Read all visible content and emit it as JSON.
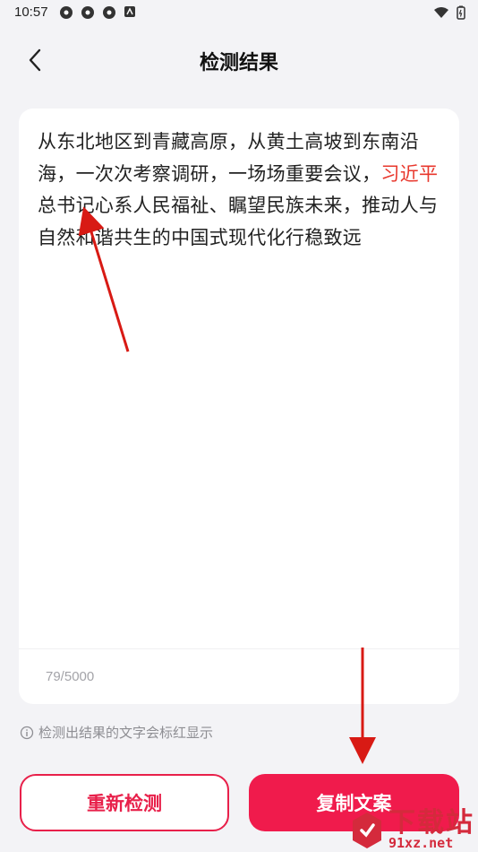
{
  "status_bar": {
    "time": "10:57"
  },
  "header": {
    "title": "检测结果"
  },
  "result": {
    "text_before": "从东北地区到青藏高原，从黄土高坡到东南沿海，一次次考察调研，一场场重要会议，",
    "highlighted": "习近平",
    "text_after": "总书记心系人民福祉、瞩望民族未来，推动人与自然和谐共生的中国式现代化行稳致远",
    "char_count": "79/5000"
  },
  "hint": {
    "text": "检测出结果的文字会标红显示"
  },
  "buttons": {
    "redetect": "重新检测",
    "copy": "复制文案"
  },
  "watermark": {
    "title": "下载站",
    "url": "91xz.net"
  },
  "colors": {
    "accent": "#f01b4c",
    "highlight": "#e8372c",
    "background": "#f3f3f6"
  }
}
